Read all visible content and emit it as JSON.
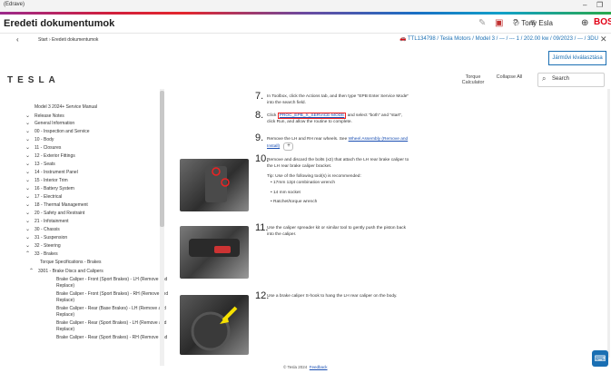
{
  "window": {
    "title": "(Edrave)"
  },
  "header": {
    "title": "Eredeti dokumentumok",
    "user": "Tony Esla",
    "brand": "BOSCH"
  },
  "breadcrumb": {
    "path": "Start › Eredeti dokumentumok",
    "vehicle": "TTL134798 / Tesla Motors / Model 3 / --- / --- 1 / 202.00 kw / 09/2023 / --- / 3DU"
  },
  "back_button": "Járművi kiválasztása",
  "manual": {
    "brand": "TESLA",
    "tools": {
      "torque": "Torque Calculator",
      "collapse": "Collapse All"
    },
    "search": "Search"
  },
  "sidebar": {
    "items": [
      {
        "label": "Model 3 2024+ Service Manual",
        "chev": ""
      },
      {
        "label": "Release Notes",
        "chev": "›"
      },
      {
        "label": "General Information",
        "chev": "›"
      },
      {
        "label": "00 - Inspection and Service",
        "chev": "›"
      },
      {
        "label": "10 - Body",
        "chev": "›"
      },
      {
        "label": "11 - Closures",
        "chev": "›"
      },
      {
        "label": "12 - Exterior Fittings",
        "chev": "›"
      },
      {
        "label": "13 - Seats",
        "chev": "›"
      },
      {
        "label": "14 - Instrument Panel",
        "chev": "›"
      },
      {
        "label": "15 - Interior Trim",
        "chev": "›"
      },
      {
        "label": "16 - Battery System",
        "chev": "›"
      },
      {
        "label": "17 - Electrical",
        "chev": "›"
      },
      {
        "label": "18 - Thermal Management",
        "chev": "›"
      },
      {
        "label": "20 - Safety and Restraint",
        "chev": "›"
      },
      {
        "label": "21 - Infotainment",
        "chev": "›"
      },
      {
        "label": "30 - Chassis",
        "chev": "›"
      },
      {
        "label": "31 - Suspension",
        "chev": "›"
      },
      {
        "label": "32 - Steering",
        "chev": "›"
      },
      {
        "label": "33 - Brakes",
        "chev": "⌄"
      },
      {
        "label": "Torque Specifications - Brakes",
        "chev": ""
      },
      {
        "label": "3301 - Brake Discs and Calipers",
        "chev": "⌄"
      },
      {
        "label": "Brake Caliper - Front (Sport Brakes) - LH (Remove and",
        "chev": ""
      },
      {
        "label": "Replace)",
        "chev": ""
      },
      {
        "label": "Brake Caliper - Front (Sport Brakes) - RH (Remove and",
        "chev": ""
      },
      {
        "label": "Replace)",
        "chev": ""
      },
      {
        "label": "Brake Caliper - Rear (Base Brakes) - LH (Remove and",
        "chev": ""
      },
      {
        "label": "Replace)",
        "chev": ""
      },
      {
        "label": "Brake Caliper - Rear (Sport Brakes) - LH (Remove and",
        "chev": ""
      },
      {
        "label": "Replace)",
        "chev": ""
      },
      {
        "label": "Brake Caliper - Rear (Sport Brakes) - RH (Remove and",
        "chev": ""
      }
    ]
  },
  "steps": {
    "s7": {
      "num": "7.",
      "text": "In Toolbox, click the Actions tab, and then type \"EPB Enter Service Mode\" into the search field."
    },
    "s8": {
      "num": "8.",
      "pre": "Click",
      "code": "PROC_EPB_X_SERVICE-MODE",
      "post": "and select \"both\" and \"start\", click Run, and allow the routine to complete."
    },
    "s9": {
      "num": "9.",
      "text": "Remove the LH and RH rear wheels. See",
      "link": "Wheel Assembly (Remove and Install)"
    },
    "s10": {
      "num": "10.",
      "text": "Remove and discard the bolts (x2) that attach the LH rear brake caliper to the LH rear brake caliper bracket.",
      "tip": "Tip: Use of the following tool(s) is recommended:",
      "tools": [
        "17mm 12pt combination wrench",
        "14 mm socket",
        "Ratchet/torque wrench"
      ]
    },
    "s11": {
      "num": "11.",
      "text": "Use the caliper spreader kit or similar tool to gently push the piston back into the caliper."
    },
    "s12": {
      "num": "12.",
      "text": "Use a brake caliper S-hook to hang the LH rear caliper on the body."
    }
  },
  "footer": {
    "copyright": "© Tesla 2024",
    "feedback": "Feedback"
  },
  "icons": {
    "edit": "edit-icon",
    "cart": "cart-icon",
    "help": "help-icon",
    "menu": "menu-icon",
    "user": "user-icon",
    "bosch": "bosch-logo-icon",
    "chat": "chat-icon"
  },
  "colors": {
    "accent": "#1a6fb3",
    "brand": "#e20015",
    "highlight": "#e22222"
  }
}
